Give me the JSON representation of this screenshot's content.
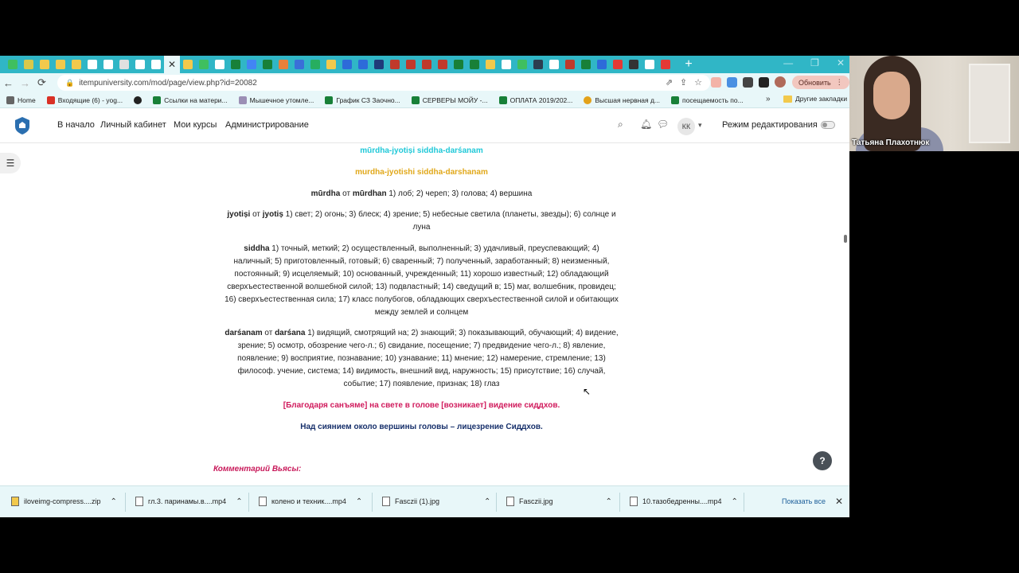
{
  "browser": {
    "url": "itempuniversity.com/mod/page/view.php?id=20082",
    "update_label": "Обновить",
    "tab_colors": [
      "#3fbf5f",
      "#d9c84a",
      "#f2c94c",
      "#f2c94c",
      "#f2c94c",
      "#e8e8e8",
      "#f2c94c",
      "#ffffff",
      "#e8e8e8",
      "#ffffff"
    ],
    "bookmarks": [
      {
        "label": "Home",
        "color": "#666666"
      },
      {
        "label": "Входящие (6) - yog...",
        "color": "#d93025"
      },
      {
        "label": "",
        "color": "#222222"
      },
      {
        "label": "Ссылки на матери...",
        "color": "#188038"
      },
      {
        "label": "Мышечное утомле...",
        "color": "#9b8fb5"
      },
      {
        "label": "График СЗ Заочно...",
        "color": "#188038"
      },
      {
        "label": "СЕРВЕРЫ МОЙУ -...",
        "color": "#188038"
      },
      {
        "label": "ОПЛАТА 2019/202...",
        "color": "#188038"
      },
      {
        "label": "Высшая нервная д...",
        "color": "#e3a21a"
      },
      {
        "label": "посещаемость по...",
        "color": "#188038"
      }
    ],
    "bookmarks_more": "»",
    "bookmarks_other": "Другие закладки"
  },
  "moodle_nav": {
    "home": "В начало",
    "dashboard": "Личный кабинет",
    "my_courses": "Мои курсы",
    "admin": "Администрирование",
    "user_initials": "КК",
    "edit_mode_label": "Режим редактирования"
  },
  "content": {
    "title_iast": "mūrdha-jyotiṣi siddha-darśanam",
    "title_translit": "murdha-jyotishi siddha-darshanam",
    "line_murdha": {
      "term": "mūrdha",
      "from": " от ",
      "root": "mūrdhan",
      "meaning": " 1) лоб; 2) череп; 3) голова; 4) вершина"
    },
    "line_jyotisi": {
      "term": "jyotiṣi",
      "from": " от ",
      "root": "jyotiṣ",
      "meaning_1": " 1) свет; 2) огонь; 3) блеск; 4) зрение; 5) небесные светила (планеты, звезды); 6) солнце и",
      "meaning_2": "луна"
    },
    "line_siddha": {
      "term": "siddha",
      "l1": " 1) точный, меткий; 2) осуществленный, выполненный; 3) удачливый, преуспевающий; 4)",
      "l2": "наличный; 5) приготовленный, готовый; 6) сваренный; 7) полученный, заработанный; 8) неизменный,",
      "l3": "постоянный; 9) исцеляемый; 10) основанный, учрежденный; 11) хорошо известный; 12) обладающий",
      "l4": "сверхъестественной волшебной силой; 13) подвластный; 14) сведущий в; 15) маг, волшебник, провидец;",
      "l5": "16) сверхъестественная сила; 17) класс полубогов, обладающих сверхъестественной силой и обитающих",
      "l6": "между землей и солнцем"
    },
    "line_darsanam": {
      "term": "darśanam",
      "from": " от ",
      "root": "darśana",
      "l1": " 1) видящий, смотрящий на; 2) знающий; 3) показывающий, обучающий; 4) видение,",
      "l2": "зрение; 5) осмотр, обозрение чего-л.; 6) свидание, посещение; 7) предвидение чего-л.; 8) явление,",
      "l3": "появление; 9) восприятие, познавание; 10) узнавание; 11) мнение; 12) намерение, стремление; 13)",
      "l4": "философ. учение, система; 14) видимость, внешний вид, наружность; 15) присутствие; 16) случай,",
      "l5": "событие; 17) появление, признак; 18) глаз"
    },
    "translation_1": "[Благодаря санъяме] на свете в голове [возникает] видение сиддхов.",
    "translation_2": "Над сиянием около вершины головы – лицезрение Сиддхов.",
    "commentary_heading": "Комментарий Вьясы:"
  },
  "help_label": "?",
  "downloads": {
    "items": [
      {
        "name": "iloveimg-compress....zip"
      },
      {
        "name": "гл.3. паринамы.в....mp4"
      },
      {
        "name": "колено и техник....mp4"
      },
      {
        "name": "Fasczii (1).jpg"
      },
      {
        "name": "Fasczii.jpg"
      },
      {
        "name": "10.тазобедренны....mp4"
      }
    ],
    "show_all": "Показать все"
  },
  "webcam": {
    "participant_name": "Татьяна Плахотнюк"
  }
}
